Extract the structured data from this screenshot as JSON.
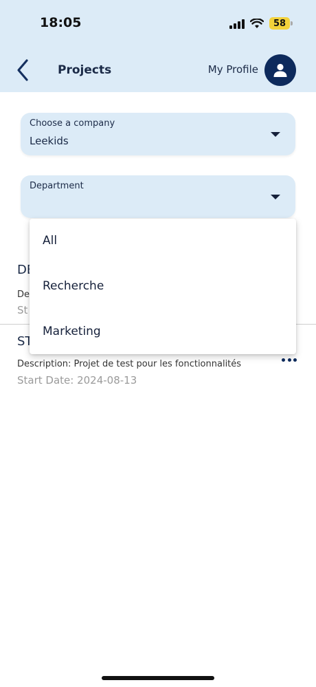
{
  "status_bar": {
    "time": "18:05",
    "battery": "58"
  },
  "header": {
    "title": "Projects",
    "profile_label": "My Profile"
  },
  "company_field": {
    "label": "Choose a company",
    "value": "Leekids"
  },
  "department_field": {
    "label": "Department",
    "value": ""
  },
  "dropdown": {
    "options": [
      "All",
      "Recherche",
      "Marketing"
    ]
  },
  "projects": [
    {
      "name_visible": "DE",
      "desc_visible": "De",
      "date_visible": "St"
    },
    {
      "name_visible": "ST",
      "description": "Description: Projet de test pour les fonctionnalités",
      "start_date": "Start Date:  2024-08-13"
    }
  ],
  "colors": {
    "header_bg": "#dcebf7",
    "accent": "#0d2a5c"
  }
}
